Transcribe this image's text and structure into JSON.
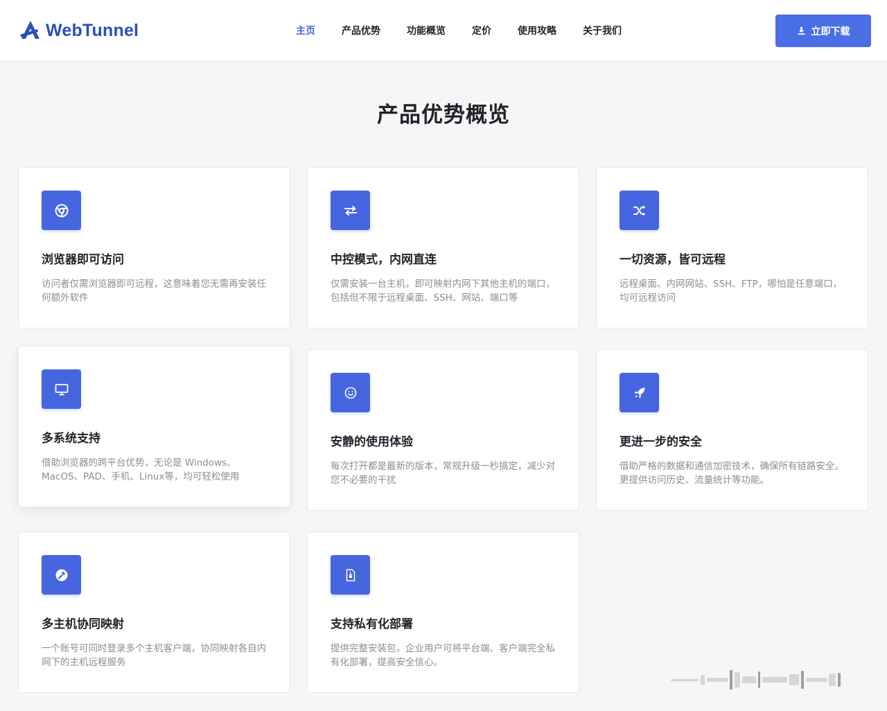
{
  "header": {
    "logo_text": "WebTunnel",
    "nav": [
      {
        "label": "主页",
        "active": true
      },
      {
        "label": "产品优势",
        "active": false
      },
      {
        "label": "功能概览",
        "active": false
      },
      {
        "label": "定价",
        "active": false
      },
      {
        "label": "使用攻略",
        "active": false
      },
      {
        "label": "关于我们",
        "active": false
      }
    ],
    "download_label": "立即下载"
  },
  "section": {
    "title": "产品优势概览"
  },
  "cards": [
    {
      "icon": "chrome-icon",
      "title": "浏览器即可访问",
      "desc": "访问者仅需浏览器即可远程，这意味着您无需再安装任何额外软件"
    },
    {
      "icon": "exchange-icon",
      "title": "中控模式，内网直连",
      "desc": "仅需安装一台主机，即可映射内网下其他主机的端口，包括但不限于远程桌面、SSH、网站、端口等"
    },
    {
      "icon": "shuffle-icon",
      "title": "一切资源，皆可远程",
      "desc": "远程桌面、内网网站、SSH、FTP，哪怕是任意端口，均可远程访问"
    },
    {
      "icon": "monitor-icon",
      "title": "多系统支持",
      "desc": "借助浏览器的跨平台优势，无论是 Windows、MacOS、PAD、手机、Linux等，均可轻松使用"
    },
    {
      "icon": "smile-icon",
      "title": "安静的使用体验",
      "desc": "每次打开都是最新的版本，常规升级一秒搞定，减少对您不必要的干扰"
    },
    {
      "icon": "rocket-icon",
      "title": "更进一步的安全",
      "desc": "借助严格的数据和通信加密技术，确保所有链路安全。更提供访问历史、流量统计等功能。"
    },
    {
      "icon": "hammer-icon",
      "title": "多主机协同映射",
      "desc": "一个账号可同时登录多个主机客户端，协同映射各自内网下的主机远程服务"
    },
    {
      "icon": "file-lock-icon",
      "title": "支持私有化部署",
      "desc": "提供完整安装包，企业用户可将平台端、客户端完全私有化部署，提高安全信心。"
    }
  ],
  "colors": {
    "brand": "#2a4fb8",
    "accent": "#4666e0",
    "nav_active": "#4366dc",
    "background": "#f6f6f7"
  }
}
